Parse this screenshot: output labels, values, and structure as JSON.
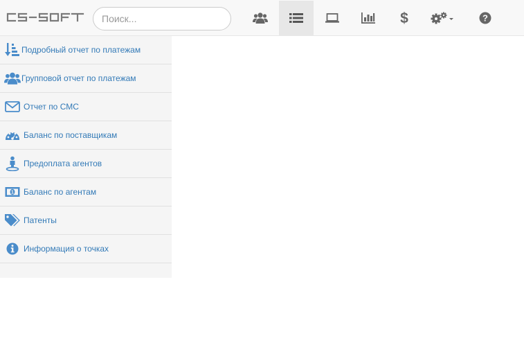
{
  "brand": {
    "name": "CS-SOFT"
  },
  "search": {
    "placeholder": "Поиск...",
    "value": ""
  },
  "nav": {
    "items": [
      {
        "icon": "users-icon"
      },
      {
        "icon": "list-icon",
        "active": true
      },
      {
        "icon": "laptop-icon"
      },
      {
        "icon": "bar-chart-icon"
      },
      {
        "icon": "dollar-icon"
      },
      {
        "icon": "settings-dropdown-icon"
      },
      {
        "icon": "help-icon"
      }
    ]
  },
  "sidebar": {
    "items": [
      {
        "label": "Подробный отчет по платежам",
        "icon": "sort-amount-icon"
      },
      {
        "label": "Групповой отчет по платежам",
        "icon": "users-icon"
      },
      {
        "label": "Отчет по СМС",
        "icon": "envelope-icon"
      },
      {
        "label": "Баланс по поставщикам",
        "icon": "dashboard-icon"
      },
      {
        "label": "Предоплата агентов",
        "icon": "street-view-icon"
      },
      {
        "label": "Баланс по агентам",
        "icon": "money-icon"
      },
      {
        "label": "Патенты",
        "icon": "tags-icon"
      },
      {
        "label": "Информация о точках",
        "icon": "info-circle-icon"
      }
    ]
  },
  "colors": {
    "link": "#337ab7",
    "icon": "#4a8cca",
    "nav_icon": "#666666",
    "navbar_bg": "#f8f8f8"
  }
}
